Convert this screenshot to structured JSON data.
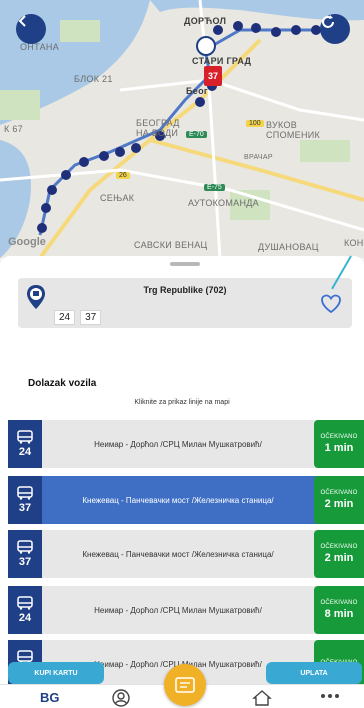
{
  "map": {
    "labels": {
      "dorcol": "ДОРЋОЛ",
      "stari_grad": "СТАРИ ГРАД",
      "beograd": "Беог",
      "blok21": "БЛОК 21",
      "ontana": "ОНТАНА",
      "blok67": "К 67",
      "beograd_na_vodi": "БЕОГРАД\nНА ВОДИ",
      "vukov_spomenik": "ВУКОВ\nСПОМЕНИК",
      "vracar": "ВРАЧАР",
      "senjak": "СЕЊАК",
      "autokomanda": "АУТОКОМАНДА",
      "savski_venac": "САВСКИ ВЕНАЦ",
      "dusanovac": "ДУШАНОВАЦ",
      "kon": "КОН"
    },
    "road_badges": {
      "e70": "E-70",
      "e75": "E-75",
      "r26": "26",
      "r100": "100"
    },
    "google": "Google",
    "vehicle_number": "37",
    "back_icon": "chevron-left-icon",
    "refresh_icon": "refresh-icon"
  },
  "stop": {
    "name": "Trg Republike (702)",
    "lines": [
      "24",
      "37"
    ],
    "favorite_icon": "heart-outline-icon"
  },
  "arrivals": {
    "title": "Dolazak vozila",
    "hint": "Kliknite za prikaz linije na mapi",
    "rows": [
      {
        "line": "24",
        "route": "Неимар - Дорћол /СРЦ Милан Мушкатровић/",
        "label": "OČEKIVANO",
        "time": "1 min",
        "active": false
      },
      {
        "line": "37",
        "route": "Кнежевац - Панчевачки мост /Железничка станица/",
        "label": "OČEKIVANO",
        "time": "2 min",
        "active": true
      },
      {
        "line": "37",
        "route": "Кнежевац - Панчевачки мост /Железничка станица/",
        "label": "OČEKIVANO",
        "time": "2 min",
        "active": false
      },
      {
        "line": "24",
        "route": "Неимар - Дорћол /СРЦ Милан Мушкатровић/",
        "label": "OČEKIVANO",
        "time": "8 min",
        "active": false
      },
      {
        "line": "24",
        "route": "Неимар - Дорћол /СРЦ Милан Мушкатровић/",
        "label": "OČEKIVANO",
        "time": "",
        "active": false
      }
    ]
  },
  "bottom": {
    "buy_ticket": "KUPI KARTU",
    "payment": "UPLATA",
    "colors": {
      "primary": "#1f3f86",
      "accent": "#39a9d4",
      "eta": "#179b3a",
      "fab": "#f0b126"
    }
  }
}
